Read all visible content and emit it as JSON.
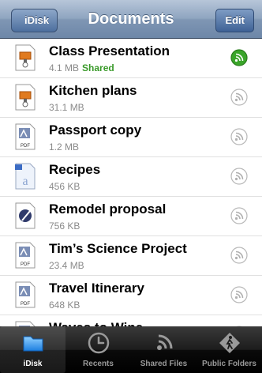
{
  "navbar": {
    "back_label": "iDisk",
    "title": "Documents",
    "edit_label": "Edit"
  },
  "files": [
    {
      "name": "Class Presentation",
      "size": "4.1 MB",
      "shared": "Shared",
      "type": "keynote",
      "active": true
    },
    {
      "name": "Kitchen plans",
      "size": "31.1 MB",
      "shared": "",
      "type": "keynote",
      "active": false
    },
    {
      "name": "Passport copy",
      "size": "1.2 MB",
      "shared": "",
      "type": "pdf",
      "active": false
    },
    {
      "name": "Recipes",
      "size": "456 KB",
      "shared": "",
      "type": "word",
      "active": false
    },
    {
      "name": "Remodel proposal",
      "size": "756 KB",
      "shared": "",
      "type": "pages",
      "active": false
    },
    {
      "name": "Tim’s Science Project",
      "size": "23.4 MB",
      "shared": "",
      "type": "pdf",
      "active": false
    },
    {
      "name": "Travel Itinerary",
      "size": "648 KB",
      "shared": "",
      "type": "pdf",
      "active": false
    },
    {
      "name": "Waves to Wine",
      "size": "",
      "shared": "",
      "type": "pdf",
      "active": false
    }
  ],
  "tabs": [
    {
      "label": "iDisk",
      "icon": "folder-icon"
    },
    {
      "label": "Recents",
      "icon": "clock-icon"
    },
    {
      "label": "Shared Files",
      "icon": "broadcast-icon"
    },
    {
      "label": "Public Folders",
      "icon": "walking-person-icon"
    }
  ],
  "colors": {
    "shared_green": "#3a9a2a",
    "nav_blue": "#7f96b4"
  }
}
